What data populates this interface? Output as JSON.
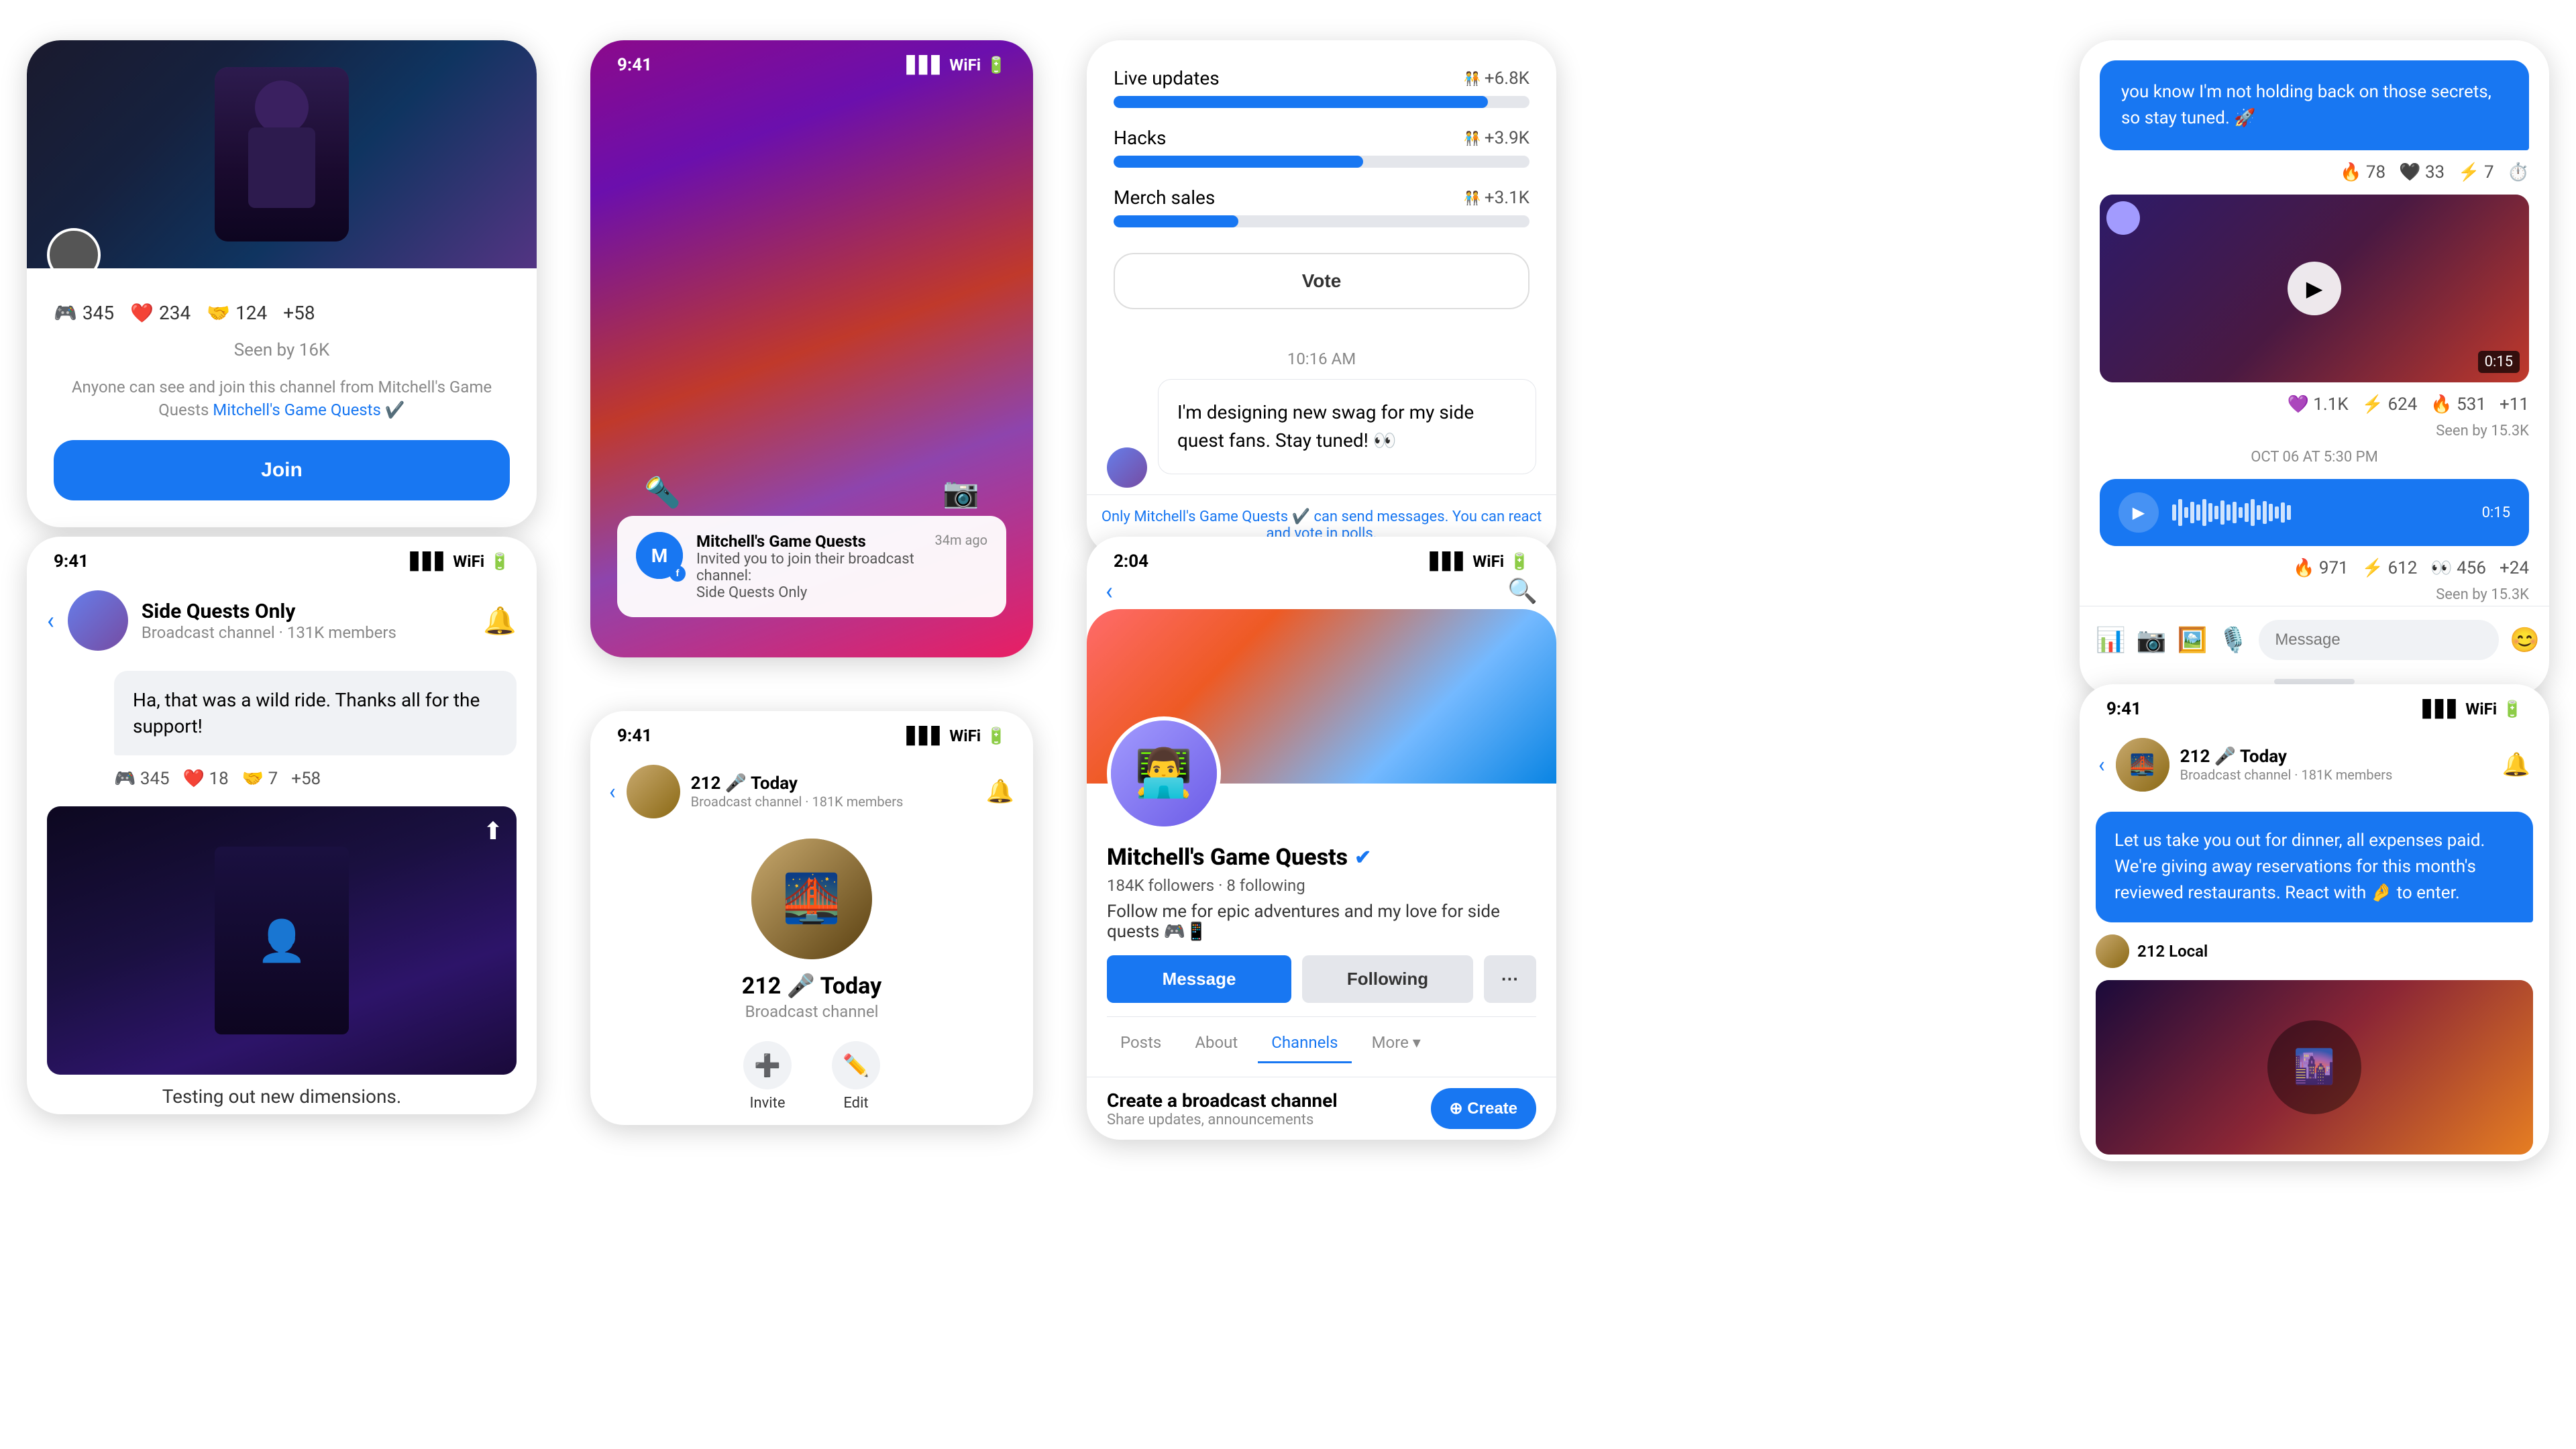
{
  "card1": {
    "reactions": [
      {
        "icon": "🎮",
        "count": "345"
      },
      {
        "icon": "❤️",
        "count": "234"
      },
      {
        "icon": "🤝",
        "count": "124"
      },
      {
        "icon": "+58",
        "count": ""
      }
    ],
    "seen_text": "Seen by 16K",
    "notice_text": "Anyone can see and join this channel from Mitchell's Game Quests",
    "channel_name": "Mitchell's Game Quests",
    "join_label": "Join"
  },
  "card2": {
    "status_time": "9:41",
    "channel_name": "Side Quests Only",
    "channel_sub": "Broadcast channel · 131K members",
    "message_text": "Ha, that was a wild ride. Thanks all for the support!",
    "reactions": [
      {
        "icon": "🎮",
        "count": "345"
      },
      {
        "icon": "❤️",
        "count": "18"
      },
      {
        "icon": "🤝",
        "count": "7"
      },
      {
        "icon": "+58",
        "count": ""
      }
    ],
    "image_caption": "Testing out new dimensions."
  },
  "card3": {
    "notif_channel": "Mitchell's Game Quests",
    "notif_text": "Invited you to join their broadcast channel:",
    "notif_sub": "Side Quests Only",
    "notif_time": "34m ago"
  },
  "card4": {
    "status_time": "9:41",
    "channel_name": "212 🎤 Today",
    "channel_sub": "Broadcast channel · 181K members",
    "channel_big_name": "212 🎤 Today",
    "channel_big_sub": "Broadcast channel",
    "invite_label": "Invite",
    "edit_label": "Edit"
  },
  "card5": {
    "poll_options": [
      {
        "label": "Live updates",
        "count": "+6.8K",
        "pct": 90
      },
      {
        "label": "Hacks",
        "count": "+3.9K",
        "pct": 60
      },
      {
        "label": "Merch sales",
        "count": "+3.1K",
        "pct": 30
      }
    ],
    "vote_label": "Vote",
    "timestamp": "10:16 AM",
    "message_text": "I'm designing new swag for my side quest fans. Stay tuned! 👀",
    "footer_note_part1": "Only Mitchell's Game Quests",
    "footer_note_part2": " can send messages. You can react and vote in polls."
  },
  "card6": {
    "status_time": "2:04",
    "channel_name": "Mitchell's Game Quests",
    "followers": "184K followers",
    "following": "8 following",
    "bio": "Follow me for epic adventures and my love for side quests 🎮📱",
    "message_label": "Message",
    "following_label": "Following",
    "more_label": "···",
    "tabs": [
      "Posts",
      "About",
      "Channels",
      "More ▾"
    ],
    "active_tab": "Channels",
    "create_channel_title": "Create a broadcast channel",
    "create_channel_sub": "Share updates, announcements",
    "create_label": "⊕ Create"
  },
  "card7": {
    "message_blue": "you know I'm not holding back on those secrets, so stay tuned. 🚀",
    "reactions1": [
      {
        "icon": "🔥",
        "count": "78"
      },
      {
        "icon": "🖤",
        "count": "33"
      },
      {
        "icon": "⚡",
        "count": "7"
      },
      {
        "icon": "⏱️",
        "count": ""
      }
    ],
    "video_duration": "0:15",
    "reactions2": [
      {
        "icon": "💜",
        "count": "1.1K"
      },
      {
        "icon": "⚡",
        "count": "624"
      },
      {
        "icon": "🔥",
        "count": "531"
      },
      {
        "icon": "+11",
        "count": ""
      }
    ],
    "seen_label": "Seen by 15.3K",
    "oct_label": "OCT 06 AT 5:30 PM",
    "audio_duration": "0:15",
    "reactions3": [
      {
        "icon": "🔥",
        "count": "971"
      },
      {
        "icon": "⚡",
        "count": "612"
      },
      {
        "icon": "👀",
        "count": "456"
      },
      {
        "icon": "+24",
        "count": ""
      }
    ],
    "message_placeholder": "Message"
  },
  "card8": {
    "status_time": "9:41",
    "channel_name": "212 🎤 Today",
    "channel_sub": "Broadcast channel · 181K members",
    "message_text": "Let us take you out for dinner, all expenses paid. We're giving away reservations for this month's reviewed restaurants. React with 🤌 to enter.",
    "sender_name": "212 Local"
  }
}
